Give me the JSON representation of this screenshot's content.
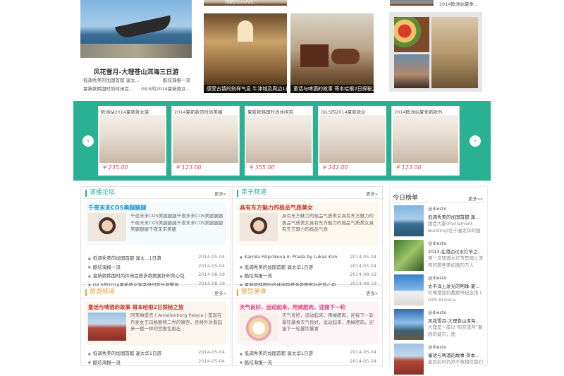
{
  "top": {
    "lake_title": "风花雪月-大理苍山洱海三日游",
    "lake_rows": [
      {
        "left": "低调秀美的加国首都 渥太...",
        "right": "酷炫海报一流"
      },
      {
        "left": "夏新款韩国时尚休闲百...",
        "right": "GILS的2014夏新款女..."
      }
    ],
    "tile_top_label": "顶部|GoneFail...",
    "hall_caption": "感受古镇的别样气息 牛津城及周边1日游",
    "street_caption": "童话与啤酒的故事 哥本哈根2日探秘之旅",
    "right_top_text": "2014欧洲站夏季..."
  },
  "carousel": {
    "prev": "‹",
    "next": "›",
    "items": [
      {
        "title": "欧洲站2014夏新款女装",
        "price": "¥ 235.00"
      },
      {
        "title": "2014夏新款范时尚美播",
        "price": "¥ 123.00"
      },
      {
        "title": "夏新款韩国时尚休闲百",
        "price": "¥ 355.00"
      },
      {
        "title": "GILS的2014夏新款女",
        "price": "¥ 242.00"
      },
      {
        "title": "2014欧洲站夏季新款时",
        "price": "¥ 123.00"
      }
    ]
  },
  "panels": [
    {
      "title": "该播论坛",
      "color": "#2ab092",
      "more": "更多»",
      "feat_title": "千夜末末COS美腿腿腿",
      "feat_title_color": "#1a8fd1",
      "feat_desc": "千夜末末COS美腿腿腿千夜末末COS美腿腿腿千夜末末COS美腿腿腿千夜末末COS美腿腿腿美腿腿腿千夜末末美腿",
      "rows": [
        {
          "t": "低调秀美的加国首都 渥太...1日游",
          "d": "2014-05-04"
        },
        {
          "t": "酷炫海报一流",
          "d": "2014-05-04"
        },
        {
          "t": "夏新款韩国时尚休闲百搭多款图案针织背心包",
          "d": "2014-08-19"
        },
        {
          "t": "GILS的2014夏新款女装字母印花长款繁色",
          "d": "2014-08-19"
        }
      ]
    },
    {
      "title": "亲子频道",
      "color": "#2ab092",
      "more": "更多»",
      "feat_title": "具有东方魅力的极品气质美女",
      "feat_title_color": "#c0392b",
      "feat_desc": "具有东方魅力的极品气质美女具有东方魅力的极品气质美女具有东方魅力的极品气质美女具有东方魅力的极品气质",
      "rows": [
        {
          "t": "Kamila Filipcikova in Prada by Lukas Kim",
          "d": "2014-05-04"
        },
        {
          "t": "低调秀美的加国首都 渥太华1日游",
          "d": "2014-05-04"
        },
        {
          "t": "酷炫海报一流",
          "d": "2014-08-19"
        },
        {
          "t": "夏新款韩国时尚休闲百搭多款图案针织背心包",
          "d": "2014-08-19"
        }
      ]
    },
    {
      "title": "旅游频道",
      "color": "#e6a23c",
      "more": "更多»",
      "feat_title": "童话与啤酒的故事 哥本哈根2日探秘之旅",
      "feat_title_color": "#c0392b",
      "feat_desc": "阿美琳堡宫 ( Amalienborg Palace ) 是现在丹麦女王玛格丽特二世的寝宫，且特外对看起来一楼一样的宫殿包围出",
      "rows": [
        {
          "t": "低调秀美的加国首都 渥太华1日游",
          "d": "2014-05-04"
        },
        {
          "t": "酷炫海报一流",
          "d": "2014-05-04"
        }
      ]
    },
    {
      "title": "餐饮美食",
      "color": "#e6a23c",
      "more": "更多»",
      "feat_title": "天气良好，运动起来，用掉肥肉，迎接下一轮",
      "feat_title_color": "#e0407a",
      "feat_desc": "天气良好，运动起来，用掉肥肉，迎接下一轮暴饮暴食天气良好，运动起来，用掉肥肉，迎接下一轮暴饮暴食",
      "rows": [
        {
          "t": "低调秀美的加国首都 渥太华1日游",
          "d": "2014-05-04"
        },
        {
          "t": "酷炫海报一流",
          "d": "2014-05-04"
        }
      ]
    }
  ],
  "rank": {
    "title": "今日榜单",
    "more": "更多»»",
    "items": [
      {
        "user": "@diesto",
        "t": "低调秀美的加国首都 渥...",
        "s": "国会大厦(Parliament Building)位于渥太华的国"
      },
      {
        "user": "@diesto",
        "t": "2013,在港迈过水灯节之...",
        "s": "第一次知道水灯节是网上流传的那些美如画的万人"
      },
      {
        "user": "@diesto",
        "t": "太平洋上发光的明珠-夏...",
        "s": "珍珠港亚利桑那号纪念馆 ( USS Arizona"
      },
      {
        "user": "@diesto",
        "t": "风花雪月-大理苍山洱海...",
        "s": "大理是一座以\"风花雪月\"著称的城市，而"
      },
      {
        "user": "@diesto",
        "t": "童话与啤酒的故事 哥本...",
        "s": "直到此时仍然不敢相信我们"
      }
    ]
  }
}
